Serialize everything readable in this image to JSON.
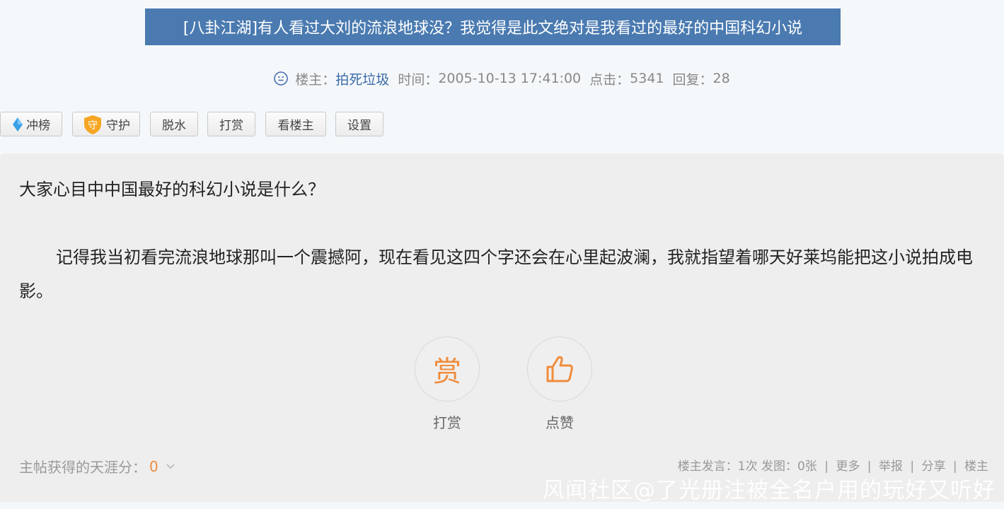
{
  "post": {
    "title": "[八卦江湖]有人看过大刘的流浪地球没？我觉得是此文绝对是我看过的最好的中国科幻小说",
    "meta": {
      "author_label": "楼主：",
      "author": "拍死垃圾",
      "time_label": "时间：",
      "time": "2005-10-13 17:41:00",
      "clicks_label": "点击：",
      "clicks": "5341",
      "replies_label": "回复：",
      "replies": "28"
    }
  },
  "toolbar": {
    "rank": "冲榜",
    "guard": "守护",
    "guard_badge": "守",
    "dehydrate": "脱水",
    "tip": "打赏",
    "author_only": "看楼主",
    "settings": "设置"
  },
  "content": {
    "question": "大家心目中中国最好的科幻小说是什么？",
    "body": "记得我当初看完流浪地球那叫一个震撼阿，现在看见这四个字还会在心里起波澜，我就指望着哪天好莱坞能把这小说拍成电影。"
  },
  "actions": {
    "tip_glyph": "赏",
    "tip_label": "打赏",
    "like_label": "点赞"
  },
  "score": {
    "label": "主帖获得的天涯分：",
    "value": "0"
  },
  "footer": {
    "speech": "楼主发言：1次",
    "images": "发图：0张",
    "more": "更多",
    "report": "举报",
    "share": "分享",
    "owner": "楼主"
  },
  "watermark": "风闻社区@了光册注被全名户用的玩好又听好",
  "colors": {
    "title_bg": "#4a7ab0",
    "accent": "#f08c3c",
    "author_link": "#3a6aa8"
  },
  "icons": [
    "smiley-icon",
    "diamond-icon",
    "shield-icon",
    "thumbs-up-icon",
    "chevron-down-icon"
  ]
}
